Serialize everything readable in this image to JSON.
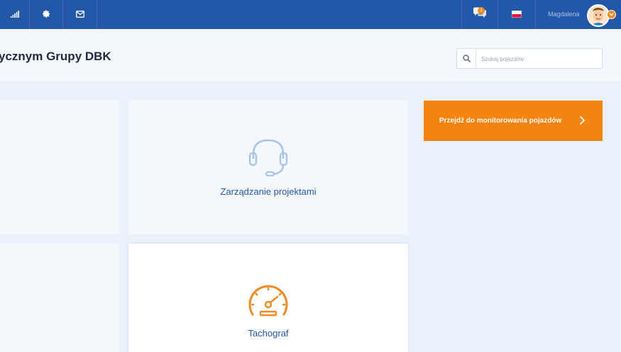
{
  "topbar": {
    "left_icons": [
      "signal-bars-icon",
      "gear-icon",
      "envelope-icon"
    ],
    "chat_badge_count": "1",
    "language_flag": "poland-flag-icon",
    "user_name": "Magdalena"
  },
  "header": {
    "page_title": "ycznym Grupy DBK",
    "search_placeholder": "Szukaj pojazdów"
  },
  "cards": [
    {
      "label": "Zarządzanie projektami",
      "icon": "headset-icon"
    },
    {
      "label": "Tachograf",
      "icon": "speedometer-icon"
    }
  ],
  "monitor_button": {
    "label": "Przejdź do monitorowania pojazdów"
  },
  "colors": {
    "topbar": "#2357a8",
    "accent_orange": "#f5830f",
    "link_blue": "#2357a8"
  }
}
